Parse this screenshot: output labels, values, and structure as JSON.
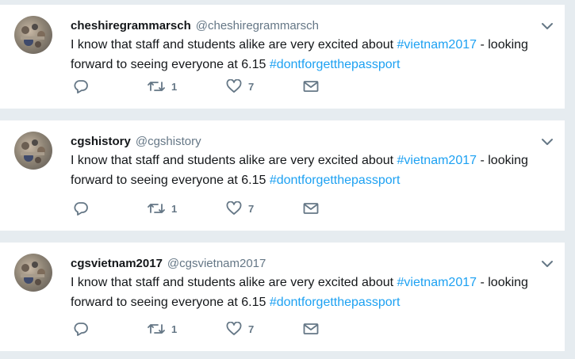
{
  "tweets": [
    {
      "name": "cheshiregrammarsch",
      "handle": "@cheshiregrammarsch",
      "text_1": "I know that staff and students alike are very excited about ",
      "tag_1": "#vietnam2017",
      "text_2": " - looking forward to seeing everyone at 6.15 ",
      "tag_2": "#dontforgetthepassport",
      "retweets": "1",
      "likes": "7"
    },
    {
      "name": "cgshistory",
      "handle": "@cgshistory",
      "text_1": "I know that staff and students alike are very excited about ",
      "tag_1": "#vietnam2017",
      "text_2": " - looking forward to seeing everyone at 6.15 ",
      "tag_2": "#dontforgetthepassport",
      "retweets": "1",
      "likes": "7"
    },
    {
      "name": "cgsvietnam2017",
      "handle": "@cgsvietnam2017",
      "text_1": "I know that staff and students alike are very excited about ",
      "tag_1": "#vietnam2017",
      "text_2": " - looking forward to seeing everyone at 6.15 ",
      "tag_2": "#dontforgetthepassport",
      "retweets": "1",
      "likes": "7"
    }
  ],
  "icons": {
    "reply": "reply-icon",
    "retweet": "retweet-icon",
    "like": "heart-icon",
    "dm": "envelope-icon",
    "menu": "chevron-down-icon"
  },
  "colors": {
    "link": "#1da1f2",
    "text": "#14171a",
    "muted": "#657786",
    "background": "#e6ecf0"
  }
}
